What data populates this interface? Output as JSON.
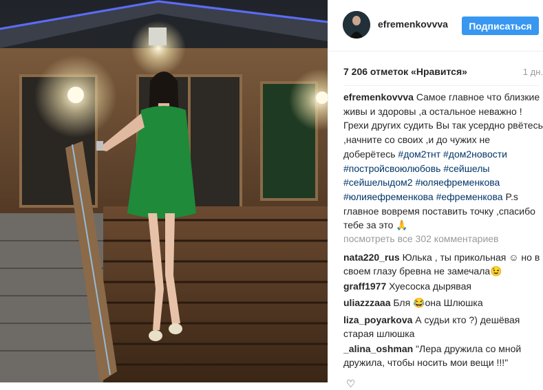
{
  "post": {
    "username": "efremenkovvva",
    "follow_label": "Подписаться",
    "likes": "7 206 отметок «Нравится»",
    "age": "1 дн.",
    "caption": {
      "username": "efremenkovvva",
      "text": "Самое главное что близкие живы и здоровы ,а остальное неважно !Грехи других судить Вы так усердно рвётесь ,начните со своих ,и до чужих не доберётесь",
      "hashtags": [
        "#дом2тнт",
        "#дом2новости",
        "#постройсвоюлюбовь",
        "#сейшелы",
        "#сейшелыдом2",
        "#юляефременкова",
        "#юлияефременкова",
        "#ефременкова"
      ],
      "tail": "P.s главное вовремя поставить точку ,спасибо тебе за это 🙏"
    },
    "view_all_comments": "посмотреть все 302 комментариев"
  },
  "comments": [
    {
      "username": "nata220_rus",
      "text": "Юлька , ты прикольная ☺ но в своем глазу бревна не замечала😉"
    },
    {
      "username": "graff1977",
      "text": "Хуесоска дырявая"
    },
    {
      "username": "uliazzzaaa",
      "text": "Бля 😂она Шлюшка"
    },
    {
      "username": "liza_poyarkova",
      "text": "А судьи кто ?) дешёвая старая шлюшка"
    },
    {
      "username": "_alina_oshman",
      "text": "\"Лера дружила со мной дружила, чтобы носить мои вещи !!!\""
    }
  ],
  "colors": {
    "follow_button": "#3897f0",
    "hashtag": "#003569",
    "muted": "#999999",
    "dress": "#1e8a3a"
  },
  "icons": {
    "like": "heart-icon"
  }
}
